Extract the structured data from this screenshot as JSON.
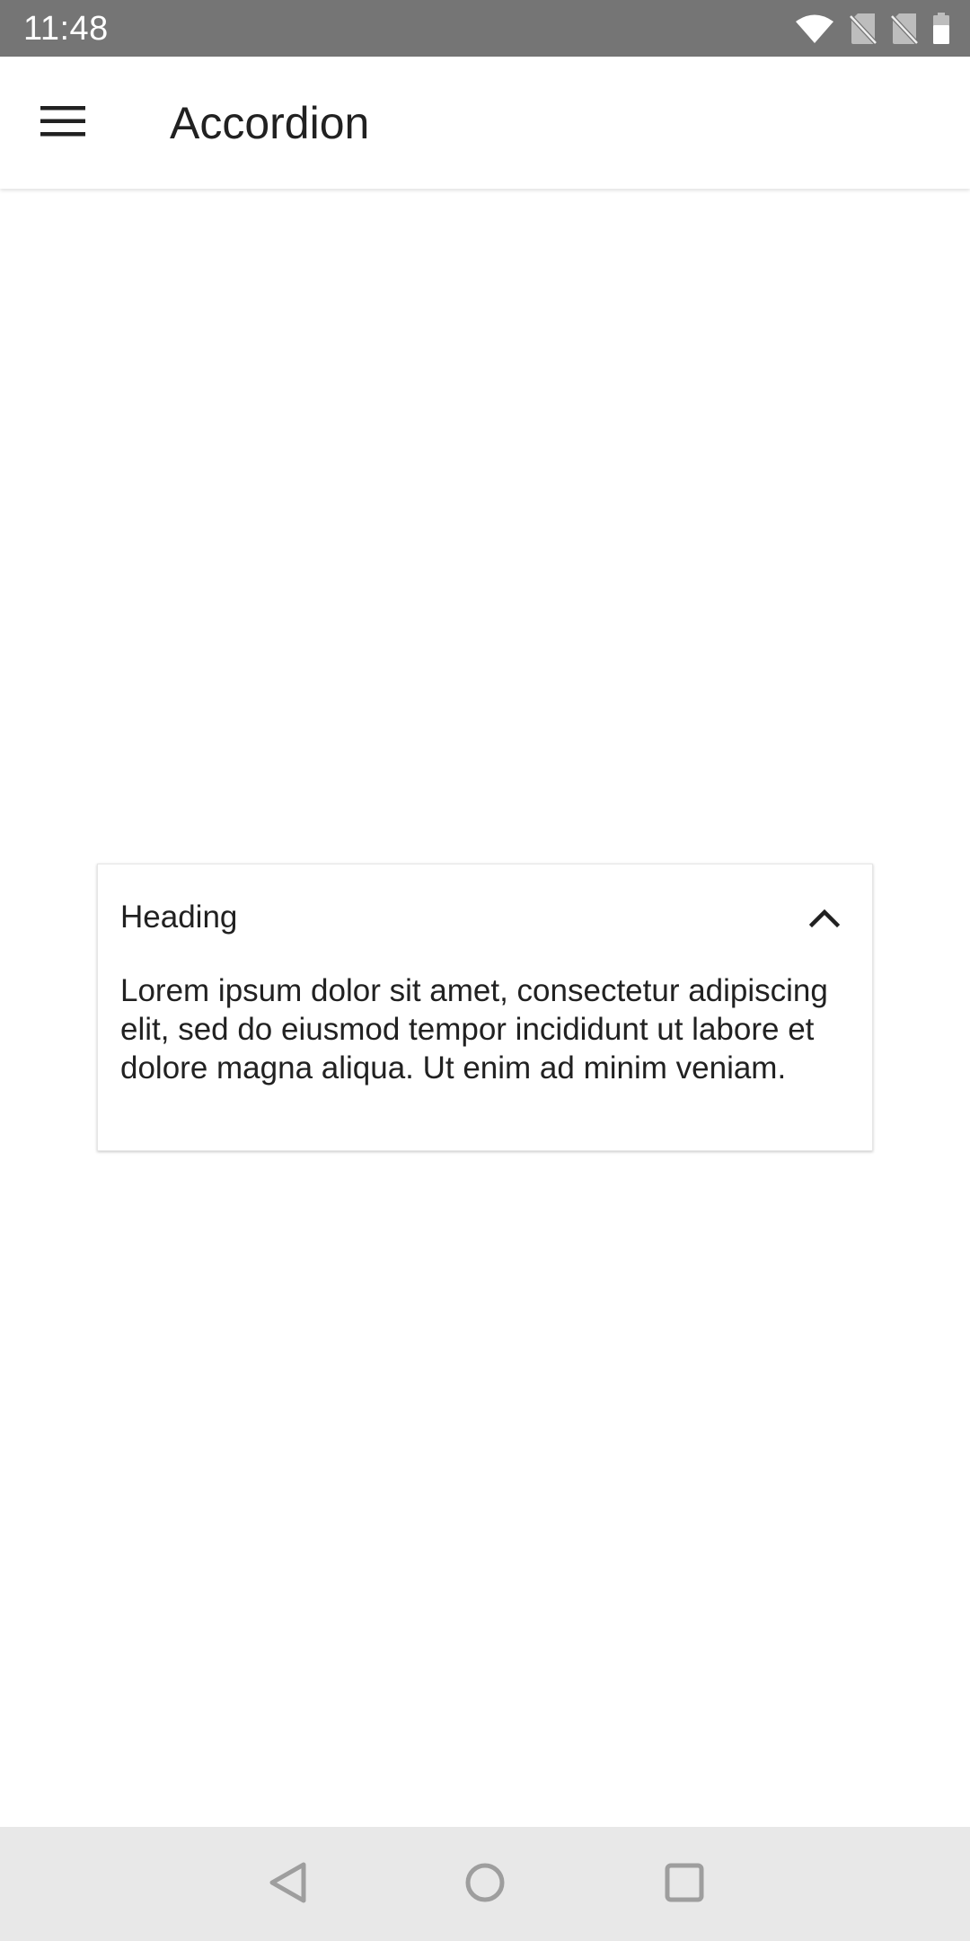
{
  "status_bar": {
    "time": "11:48",
    "icons": [
      "wifi-icon",
      "no-sim-icon",
      "no-sim-icon",
      "battery-icon"
    ]
  },
  "app_bar": {
    "menu_icon": "hamburger-menu-icon",
    "title": "Accordion"
  },
  "accordion": {
    "heading": "Heading",
    "expanded": true,
    "toggle_icon": "chevron-up-icon",
    "body": "Lorem ipsum dolor sit amet, consectetur adipiscing elit, sed do eiusmod tempor incididunt ut labore et dolore magna aliqua. Ut enim ad minim veniam."
  },
  "nav_bar": {
    "buttons": [
      "back-icon",
      "home-icon",
      "recents-icon"
    ]
  },
  "colors": {
    "status_bar": "#757575",
    "nav_bar": "#e8e8e8",
    "text": "#212121",
    "nav_icon": "#9e9e9e"
  }
}
